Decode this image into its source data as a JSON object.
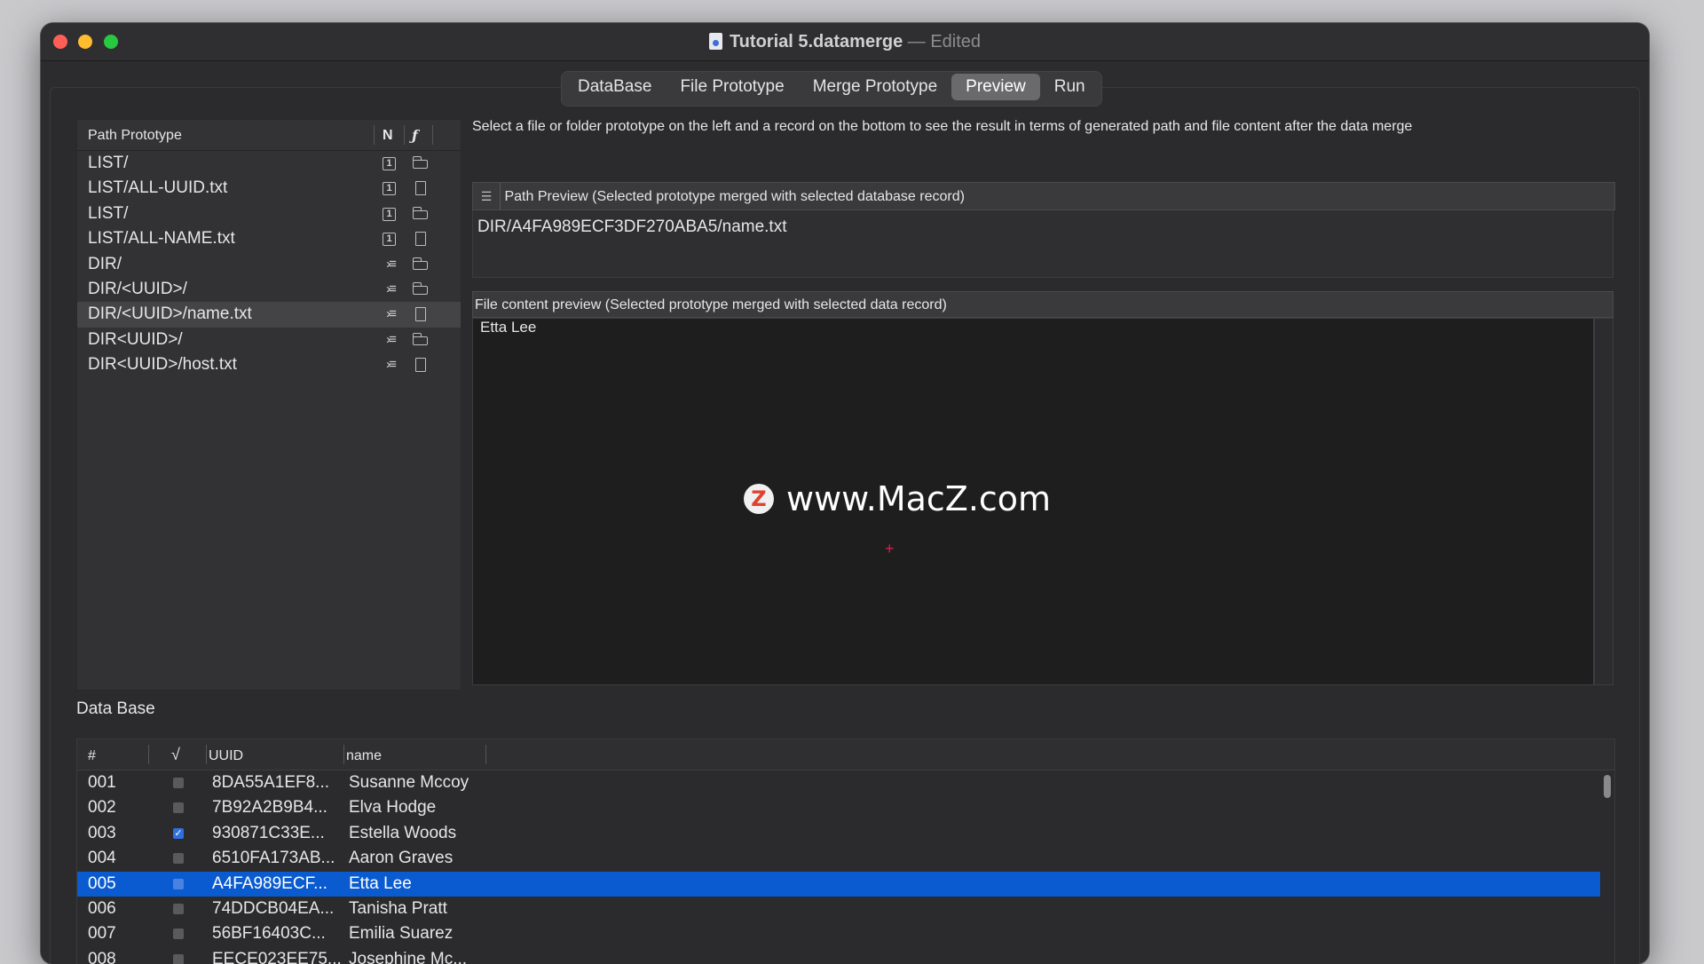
{
  "window": {
    "title": "Tutorial 5.datamerge",
    "status": "Edited",
    "separator": "—"
  },
  "tabs": [
    {
      "label": "DataBase",
      "active": false
    },
    {
      "label": "File Prototype",
      "active": false
    },
    {
      "label": "Merge Prototype",
      "active": false
    },
    {
      "label": "Preview",
      "active": true
    },
    {
      "label": "Run",
      "active": false
    }
  ],
  "path_prototype": {
    "header": {
      "path": "Path Prototype",
      "n": "N",
      "f": "ƒ"
    },
    "rows": [
      {
        "path": "LIST/",
        "kind_icon": "one-icon",
        "kind_text": "1",
        "type_icon": "folder-icon"
      },
      {
        "path": "LIST/ALL-UUID.txt",
        "kind_icon": "one-icon",
        "kind_text": "1",
        "type_icon": "file-icon"
      },
      {
        "path": "LIST/",
        "kind_icon": "one-icon",
        "kind_text": "1",
        "type_icon": "folder-icon"
      },
      {
        "path": "LIST/ALL-NAME.txt",
        "kind_icon": "one-icon",
        "kind_text": "1",
        "type_icon": "file-icon"
      },
      {
        "path": "DIR/",
        "kind_icon": "merge-list-icon",
        "kind_text": "›≡",
        "type_icon": "folder-icon"
      },
      {
        "path": "DIR/<UUID>/",
        "kind_icon": "merge-list-icon",
        "kind_text": "›≡",
        "type_icon": "folder-icon"
      },
      {
        "path": "DIR/<UUID>/name.txt",
        "kind_icon": "merge-list-icon",
        "kind_text": "›≡",
        "type_icon": "file-icon",
        "selected": true
      },
      {
        "path": "DIR<UUID>/",
        "kind_icon": "merge-list-icon",
        "kind_text": "›≡",
        "type_icon": "folder-icon"
      },
      {
        "path": "DIR<UUID>/host.txt",
        "kind_icon": "merge-list-icon",
        "kind_text": "›≡",
        "type_icon": "file-icon"
      }
    ]
  },
  "instructions": "Select a file or folder prototype  on the left and a record on the bottom to see the result in terms of generated path and file content after the data merge",
  "path_preview": {
    "header": "Path Preview (Selected prototype merged with selected database record)",
    "value": "DIR/A4FA989ECF3DF270ABA5/name.txt"
  },
  "file_preview": {
    "header": "File content preview (Selected prototype merged with selected data record)",
    "content": "Etta Lee"
  },
  "watermark": {
    "logo": "Z",
    "text": "www.MacZ.com"
  },
  "database": {
    "label": "Data Base",
    "columns": {
      "num": "#",
      "check": "√",
      "uuid": "UUID",
      "name": "name"
    },
    "rows": [
      {
        "num": "001",
        "checked": false,
        "uuid": "8DA55A1EF8...",
        "name": "Susanne Mccoy"
      },
      {
        "num": "002",
        "checked": false,
        "uuid": "7B92A2B9B4...",
        "name": "Elva Hodge"
      },
      {
        "num": "003",
        "checked": true,
        "uuid": "930871C33E...",
        "name": "Estella Woods"
      },
      {
        "num": "004",
        "checked": false,
        "uuid": "6510FA173AB...",
        "name": "Aaron Graves"
      },
      {
        "num": "005",
        "checked": false,
        "uuid": "A4FA989ECF...",
        "name": "Etta Lee",
        "selected": true
      },
      {
        "num": "006",
        "checked": false,
        "uuid": "74DDCB04EA...",
        "name": "Tanisha Pratt"
      },
      {
        "num": "007",
        "checked": false,
        "uuid": "56BF16403C...",
        "name": "Emilia Suarez"
      },
      {
        "num": "008",
        "checked": false,
        "uuid": "EECE023EE75...",
        "name": "Josephine Mc..."
      }
    ]
  }
}
